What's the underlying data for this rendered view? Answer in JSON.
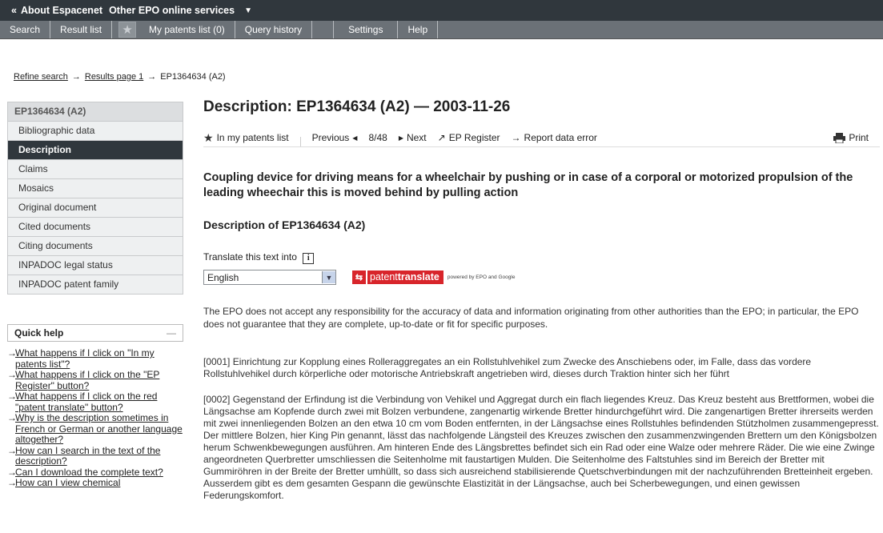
{
  "topbar": {
    "about": "About Espacenet",
    "other": "Other EPO online services"
  },
  "nav": {
    "search": "Search",
    "result_list": "Result list",
    "my_patents": "My patents list (0)",
    "query_history": "Query history",
    "settings": "Settings",
    "help": "Help"
  },
  "breadcrumb": {
    "refine": "Refine search",
    "results": "Results page 1",
    "current": "EP1364634 (A2)"
  },
  "sidebar": {
    "head": "EP1364634  (A2)",
    "items": [
      "Bibliographic data",
      "Description",
      "Claims",
      "Mosaics",
      "Original document",
      "Cited documents",
      "Citing documents",
      "INPADOC legal status",
      "INPADOC patent family"
    ],
    "active_index": 1
  },
  "quick_help": {
    "title": "Quick help",
    "collapse": "—",
    "items": [
      "What happens if I click on \"In my patents list\"?",
      "What happens if I click on the \"EP Register\" button?",
      "What happens if I click on the red \"patent translate\" button?",
      "Why is the description sometimes in French or German or another language altogether?",
      "How can I search in the text of the description?",
      "Can I download the complete text?",
      "How can I view chemical"
    ]
  },
  "main": {
    "title": "Description: EP1364634  (A2) — 2003-11-26",
    "toolbar": {
      "in_list": "In my patents list",
      "previous": "Previous",
      "counter": "8/48",
      "next": "Next",
      "register": "EP Register",
      "report": "Report data error",
      "print": "Print"
    },
    "heading": "Coupling device for driving means for a wheelchair by pushing or in case of a corporal or motorized propulsion of the leading wheechair this is moved behind by pulling action",
    "desc_heading": "Description of EP1364634 (A2)",
    "translate_label": "Translate this text into",
    "language": "English",
    "pt_logo": {
      "prefix": "patent",
      "suffix": "translate"
    },
    "powered": "powered by EPO and Google",
    "disclaimer": "The EPO does not accept any responsibility for the accuracy of data and information originating from other authorities than the EPO; in particular, the EPO does not guarantee that they are complete, up-to-date or fit for specific purposes.",
    "para1": "[0001] Einrichtung zur Kopplung eines Rolleraggregates an ein Rollstuhlvehikel zum Zwecke des Anschiebens oder, im Falle, dass das vordere Rollstuhlvehikel durch körperliche oder motorische Antriebskraft angetrieben wird, dieses durch Traktion hinter sich her führt",
    "para2": "[0002] Gegenstand der Erfindung ist die Verbindung von Vehikel und Aggregat durch ein flach liegendes Kreuz. Das Kreuz besteht aus Brettformen, wobei die Längsachse am Kopfende durch zwei mit Bolzen verbundene, zangenartig wirkende Bretter hindurchgeführt wird. Die zangenartigen Bretter ihrerseits werden mit zwei innenliegenden Bolzen an den etwa 10 cm vom Boden entfernten, in der Längsachse eines Rollstuhles befindenden Stützholmen zusammengepresst. Der mittlere Bolzen, hier King Pin genannt, lässt das nachfolgende Längsteil des Kreuzes zwischen den zusammenzwingenden Brettern um den Königsbolzen herum Schwenkbewegungen ausführen. Am hinteren Ende des Längsbrettes befindet sich ein Rad oder eine Walze oder mehrere Räder. Die wie eine Zwinge angeordneten Querbretter umschliessen die Seitenholme mit faustartigen Mulden. Die Seitenholme des Faltstuhles sind im Bereich der Bretter mit Gummiröhren in der Breite der Bretter umhüllt, so dass sich ausreichend stabilisierende Quetschverbindungen mit der nachzuführenden Bretteinheit ergeben. Ausserdem gibt es dem gesamten Gespann die gewünschte Elastizität in der Längsachse, auch bei Scherbewegungen, und einen gewissen Federungskomfort."
  }
}
